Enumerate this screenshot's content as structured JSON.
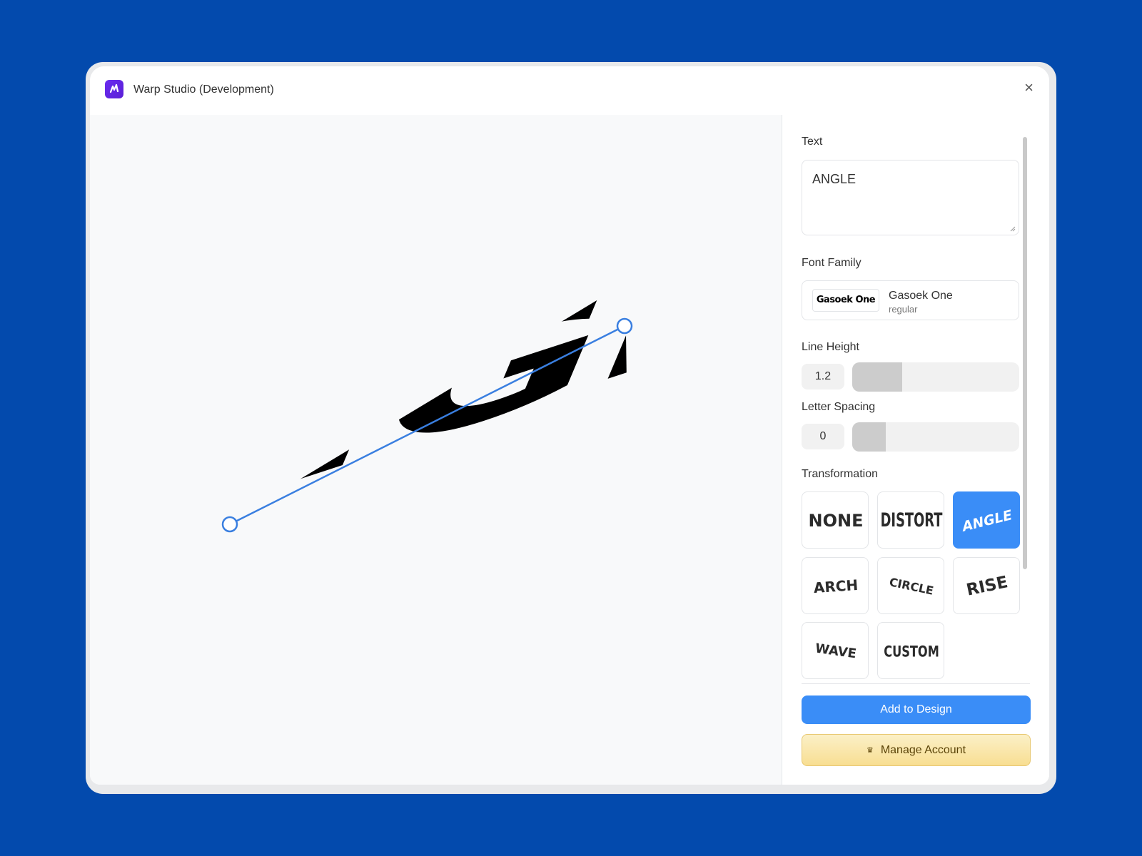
{
  "window": {
    "title": "Warp Studio (Development)",
    "close_glyph": "×"
  },
  "preview": {
    "text": "ANGLE"
  },
  "sidebar": {
    "text_label": "Text",
    "text_value": "ANGLE",
    "font_family_label": "Font Family",
    "font_preview": "Gasoek One",
    "font_name": "Gasoek One",
    "font_style": "regular",
    "line_height_label": "Line Height",
    "line_height_value": "1.2",
    "line_height_level": 0.3,
    "letter_spacing_label": "Letter Spacing",
    "letter_spacing_value": "0",
    "letter_spacing_level": 0.2,
    "transformation_label": "Transformation",
    "transformations": [
      {
        "label": "NONE",
        "selected": false
      },
      {
        "label": "DISTORT",
        "selected": false
      },
      {
        "label": "ANGLE",
        "selected": true
      },
      {
        "label": "ARCH",
        "selected": false
      },
      {
        "label": "CIRCLE",
        "selected": false
      },
      {
        "label": "RISE",
        "selected": false
      },
      {
        "label": "WAVE",
        "selected": false
      },
      {
        "label": "CUSTOM",
        "selected": false
      }
    ],
    "add_button": "Add to Design",
    "manage_button": "Manage Account",
    "crown_glyph": "♛"
  },
  "colors": {
    "background": "#034aad",
    "accent": "#3a8df7",
    "brand": "#6a2cf0",
    "gold": "#f8de92"
  },
  "icons": [
    "app-logo-icon",
    "close-icon",
    "resize-grip-icon",
    "crown-icon"
  ]
}
